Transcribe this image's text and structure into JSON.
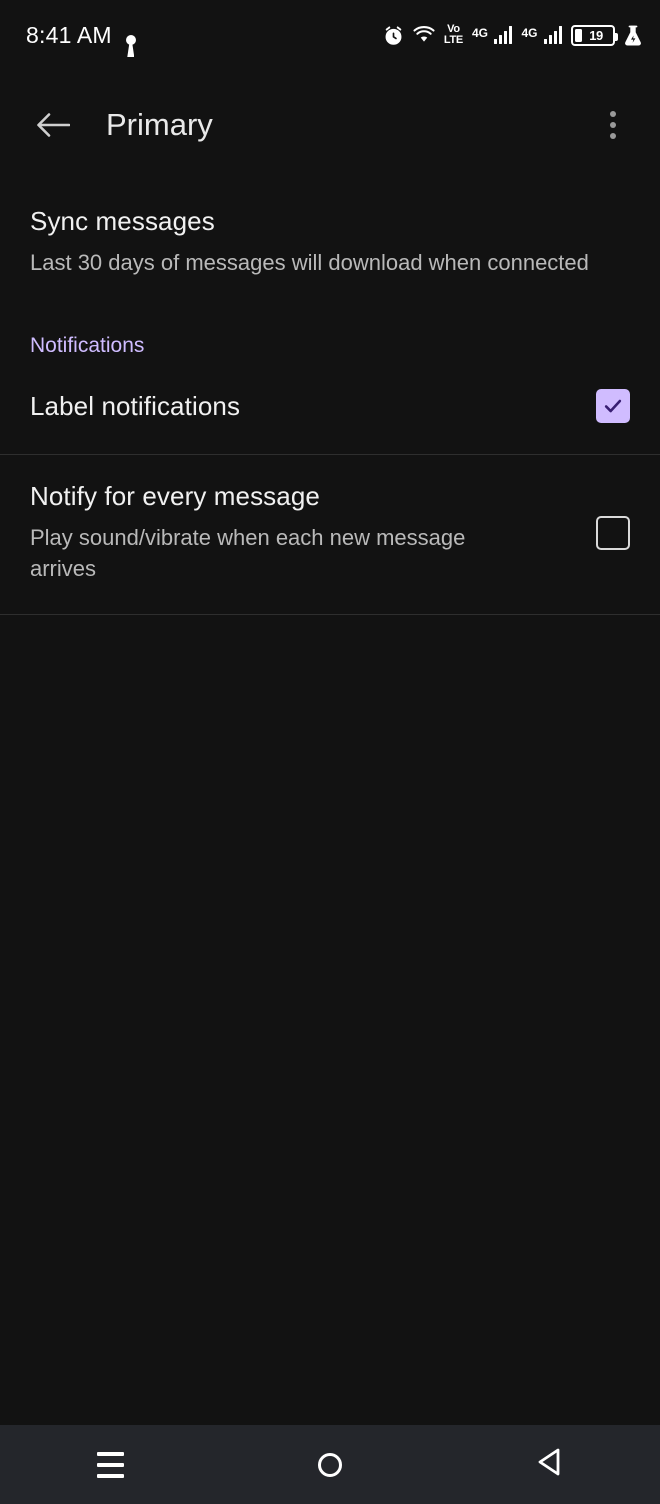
{
  "status_bar": {
    "time": "8:41 AM",
    "secure_icon": "keyhole-icon",
    "alarm_icon": "alarm-clock-icon",
    "wifi_icon": "wifi-icon",
    "volte_top": "Vo",
    "volte_bottom": "LTE",
    "sim1_network": "4G",
    "sim2_network": "4G",
    "battery_level": "19",
    "lab_icon": "flask-icon"
  },
  "app_bar": {
    "back_icon": "back-arrow-icon",
    "title": "Primary",
    "overflow_icon": "more-vertical-icon"
  },
  "sync": {
    "title": "Sync messages",
    "subtitle": "Last 30 days of messages will download when connected"
  },
  "notifications": {
    "section_label": "Notifications",
    "accent_color": "#cfbcff",
    "rows": [
      {
        "title": "Label notifications",
        "subtitle": "",
        "checked": true,
        "checkbox_color": "#d0bcff",
        "check_mark": "✓"
      },
      {
        "title": "Notify for every message",
        "subtitle": "Play sound/vibrate when each new message arrives",
        "checked": false,
        "checkbox_color": "#d9d9d9",
        "check_mark": ""
      }
    ]
  },
  "nav_bar": {
    "recents_icon": "menu-recents-icon",
    "home_icon": "home-circle-icon",
    "back_icon": "back-triangle-icon"
  }
}
